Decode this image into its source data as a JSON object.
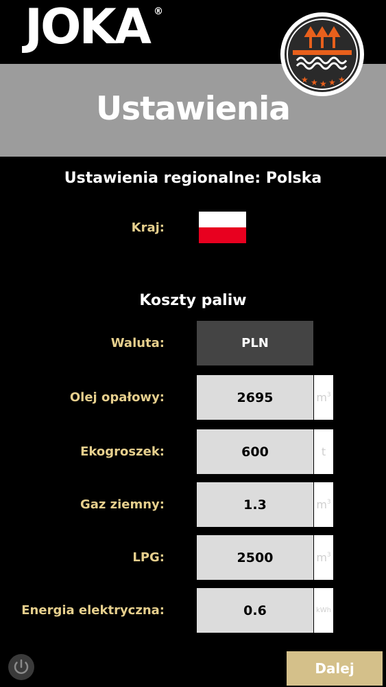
{
  "header": {
    "logo_text": "JOKA",
    "logo_mark": "®",
    "badge_icon": "heating-badge-icon"
  },
  "title": "Ustawienia",
  "region": {
    "heading": "Ustawienia regionalne: Polska",
    "country_label": "Kraj:",
    "flag_colors": [
      "#ffffff",
      "#e8001f"
    ]
  },
  "fuel": {
    "heading": "Koszty paliw",
    "currency_label": "Waluta:",
    "currency_value": "PLN",
    "items": [
      {
        "label": "Olej opałowy:",
        "value": "2695",
        "unit": "m",
        "unit_sup": "3"
      },
      {
        "label": "Ekogroszek:",
        "value": "600",
        "unit": "t",
        "unit_sup": ""
      },
      {
        "label": "Gaz ziemny:",
        "value": "1.3",
        "unit": "m",
        "unit_sup": "3"
      },
      {
        "label": "LPG:",
        "value": "2500",
        "unit": "m",
        "unit_sup": "3"
      },
      {
        "label": "Energia elektryczna:",
        "value": "0.6",
        "unit": "kWh",
        "unit_sup": ""
      }
    ]
  },
  "footer": {
    "power_icon": "power-icon",
    "next_label": "Dalej"
  },
  "colors": {
    "accent_gold": "#e6cf8d",
    "button_gold": "#d4c08a",
    "title_bar": "#9c9c9c",
    "badge_orange": "#e8601c"
  }
}
